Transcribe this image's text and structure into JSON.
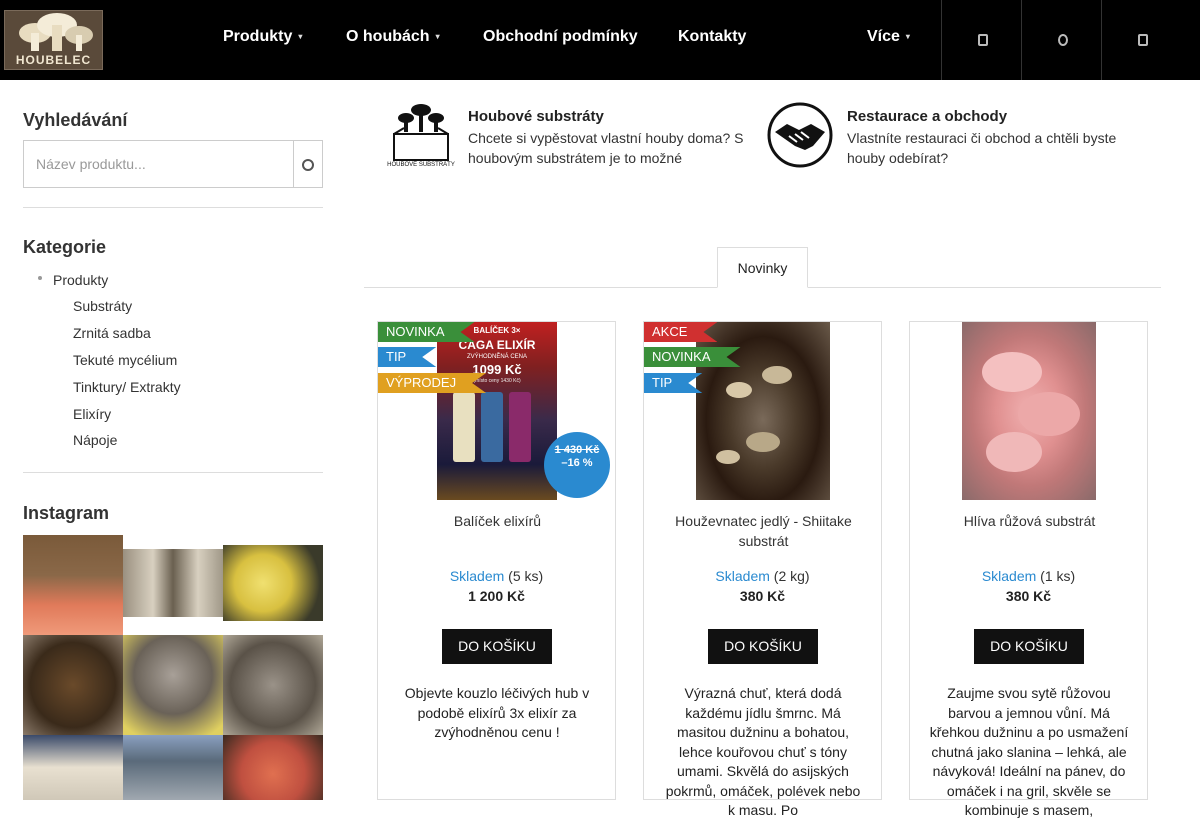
{
  "header": {
    "logo_text": "HOUBELEC",
    "nav": [
      {
        "label": "Produkty"
      },
      {
        "label": "O houbách"
      },
      {
        "label": "Obchodní podmínky"
      },
      {
        "label": "Kontakty"
      },
      {
        "label": "Více"
      }
    ],
    "icons": [
      "user-icon",
      "search-icon",
      "cart-icon"
    ]
  },
  "sidebar": {
    "search_title": "Vyhledávání",
    "search_placeholder": "Název produktu...",
    "categories_title": "Kategorie",
    "categories": {
      "root": "Produkty",
      "children": [
        "Substráty",
        "Zrnitá sadba",
        "Tekuté mycélium",
        "Tinktury/ Extrakty",
        "Elixíry",
        "Nápoje"
      ]
    },
    "instagram_title": "Instagram"
  },
  "promos": [
    {
      "title": "Houbové substráty",
      "desc": "Chcete si vypěstovat vlastní houby doma? S houbovým substrátem je to možné"
    },
    {
      "title": "Restaurace a obchody",
      "desc": "Vlastníte restauraci či obchod a chtěli byste houby odebírat?"
    }
  ],
  "tabs": {
    "active": "Novinky"
  },
  "products": [
    {
      "badges": [
        "NOVINKA",
        "TIP",
        "VÝPRODEJ"
      ],
      "name": "Balíček elixírů",
      "stock_label": "Skladem",
      "stock_qty": "(5 ks)",
      "price": "1 200 Kč",
      "old_price": "1 430 Kč",
      "discount": "–16 %",
      "buy_label": "DO KOŠÍKU",
      "desc": "Objevte kouzlo léčivých hub v podobě elixírů  3x elixír  za zvýhodněnou cenu !",
      "img_text": [
        "BALÍČEK 3×",
        "ČAGA ELIXÍR",
        "ZVÝHODNĚNÁ CENA",
        "1099 Kč",
        "(místo ceny 1430 Kč)"
      ]
    },
    {
      "badges": [
        "AKCE",
        "NOVINKA",
        "TIP"
      ],
      "name": "Houževnatec jedlý - Shiitake substrát",
      "stock_label": "Skladem",
      "stock_qty": "(2 kg)",
      "price": "380 Kč",
      "buy_label": "DO KOŠÍKU",
      "desc": "Výrazná chuť, která dodá každému jídlu šmrnc. Má masitou dužninu a bohatou, lehce kouřovou chuť s tóny umami. Skvělá do asijských pokrmů, omáček, polévek nebo k masu. Po"
    },
    {
      "badges": [],
      "name": "Hlíva růžová substrát",
      "stock_label": "Skladem",
      "stock_qty": "(1 ks)",
      "price": "380 Kč",
      "buy_label": "DO KOŠÍKU",
      "desc": "Zaujme svou sytě růžovou barvou a jemnou vůní. Má křehkou dužninu a po usmažení chutná jako slanina – lehká, ale návyková! Ideální na pánev, do omáček i na gril, skvěle se kombinuje s masem,"
    }
  ],
  "colors": {
    "header_bg": "#000000",
    "novinka": "#3a8f3a",
    "tip": "#2a8ad0",
    "vyprodej": "#e0a020",
    "akce": "#d03030",
    "stock": "#2a8ad0"
  }
}
